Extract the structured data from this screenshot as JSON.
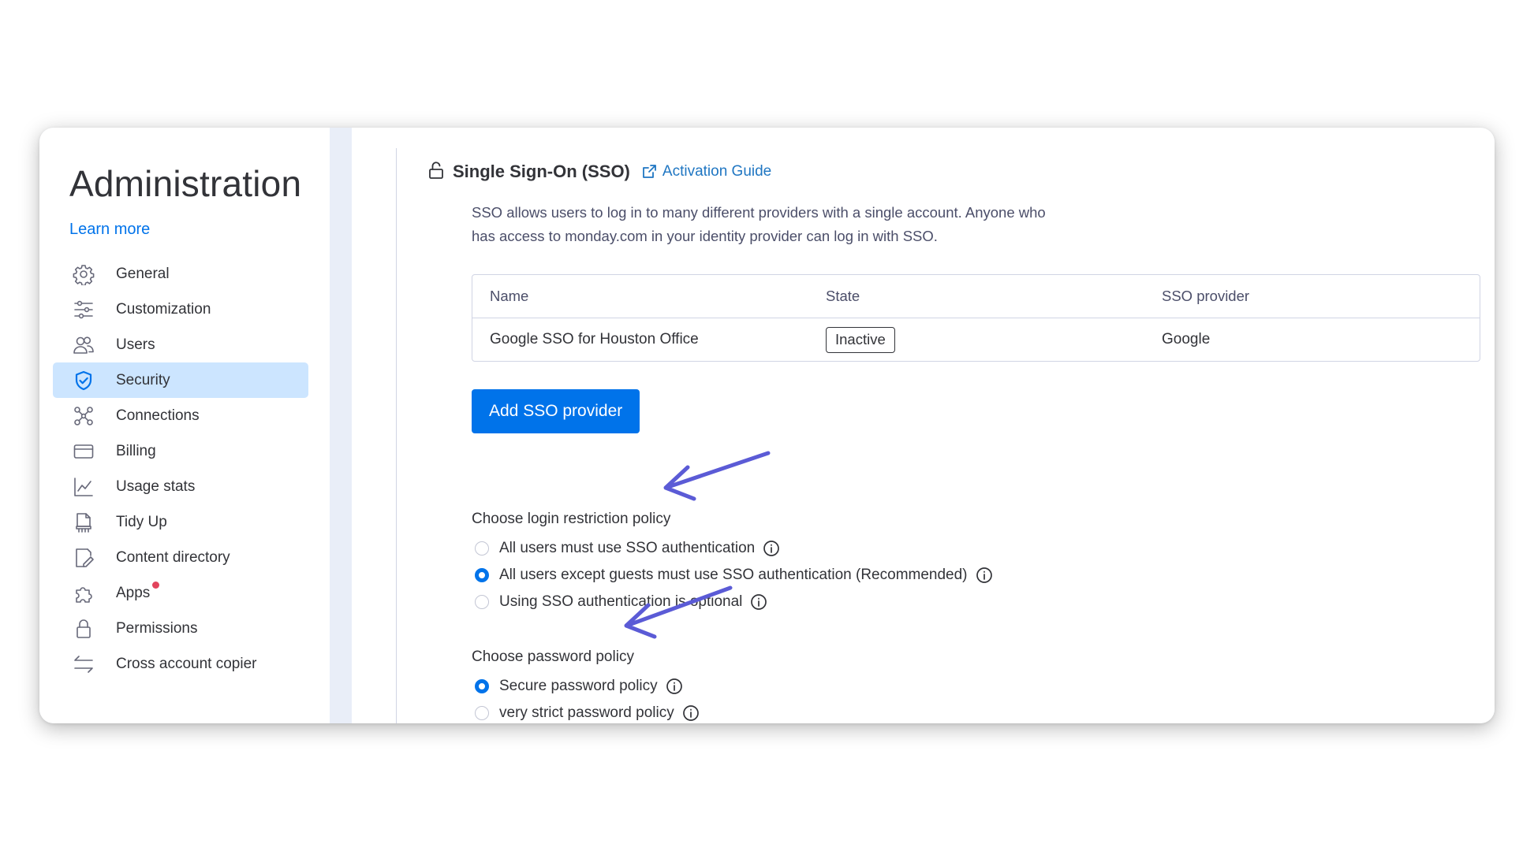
{
  "sidebar": {
    "title": "Administration",
    "learn_more": "Learn more",
    "items": [
      {
        "label": "General",
        "icon": "gear-icon",
        "active": false
      },
      {
        "label": "Customization",
        "icon": "sliders-icon",
        "active": false
      },
      {
        "label": "Users",
        "icon": "users-icon",
        "active": false
      },
      {
        "label": "Security",
        "icon": "shield-icon",
        "active": true
      },
      {
        "label": "Connections",
        "icon": "connections-icon",
        "active": false
      },
      {
        "label": "Billing",
        "icon": "credit-card-icon",
        "active": false
      },
      {
        "label": "Usage stats",
        "icon": "chart-line-icon",
        "active": false
      },
      {
        "label": "Tidy Up",
        "icon": "tidy-up-icon",
        "active": false
      },
      {
        "label": "Content directory",
        "icon": "content-directory-icon",
        "active": false
      },
      {
        "label": "Apps",
        "icon": "puzzle-icon",
        "active": false,
        "badge": true
      },
      {
        "label": "Permissions",
        "icon": "lock-icon",
        "active": false
      },
      {
        "label": "Cross account copier",
        "icon": "arrows-swap-icon",
        "active": false
      }
    ]
  },
  "sso": {
    "title": "Single Sign-On (SSO)",
    "activation_guide": "Activation Guide",
    "description": "SSO allows users to log in to many different providers with a single account. Anyone who has access to monday.com in your identity provider can log in with SSO.",
    "table": {
      "headers": [
        "Name",
        "State",
        "SSO provider"
      ],
      "rows": [
        {
          "name": "Google SSO for Houston Office",
          "state": "Inactive",
          "provider": "Google"
        }
      ]
    },
    "add_button": "Add SSO provider"
  },
  "login_policy": {
    "heading": "Choose login restriction policy",
    "options": [
      {
        "label": "All users must use SSO authentication",
        "checked": false
      },
      {
        "label": "All users except guests must use SSO authentication (Recommended)",
        "checked": true
      },
      {
        "label": "Using SSO authentication is optional",
        "checked": false
      }
    ]
  },
  "password_policy": {
    "heading": "Choose password policy",
    "options": [
      {
        "label": "Secure password policy",
        "checked": true
      },
      {
        "label": "very strict password policy",
        "checked": false
      }
    ]
  },
  "colors": {
    "accent": "#0073ea",
    "active_nav_bg": "#cce5ff",
    "annotation_arrow": "#5b5bd6",
    "apps_badge": "#e2445c"
  }
}
